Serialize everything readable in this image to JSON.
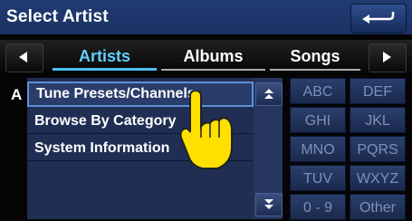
{
  "header": {
    "title": "Select Artist"
  },
  "tabs": [
    {
      "label": "Artists",
      "active": true
    },
    {
      "label": "Albums",
      "active": false
    },
    {
      "label": "Songs",
      "active": false
    }
  ],
  "index_letter": "A",
  "list": {
    "items": [
      {
        "label": "Tune Presets/Channels",
        "selected": true
      },
      {
        "label": "Browse By Category",
        "selected": false
      },
      {
        "label": "System Information",
        "selected": false
      }
    ]
  },
  "keypad": {
    "keys": [
      "ABC",
      "DEF",
      "GHI",
      "JKL",
      "MNO",
      "PQRS",
      "TUV",
      "WXYZ",
      "0 - 9",
      "Other"
    ]
  },
  "colors": {
    "header": "#1f396d",
    "active_tab": "#5fd0ff",
    "list_bg": "#1f2e52"
  },
  "icons": [
    "back-icon",
    "left-arrow-icon",
    "right-arrow-icon",
    "scroll-up-icon",
    "scroll-down-icon",
    "pointing-hand-icon"
  ]
}
